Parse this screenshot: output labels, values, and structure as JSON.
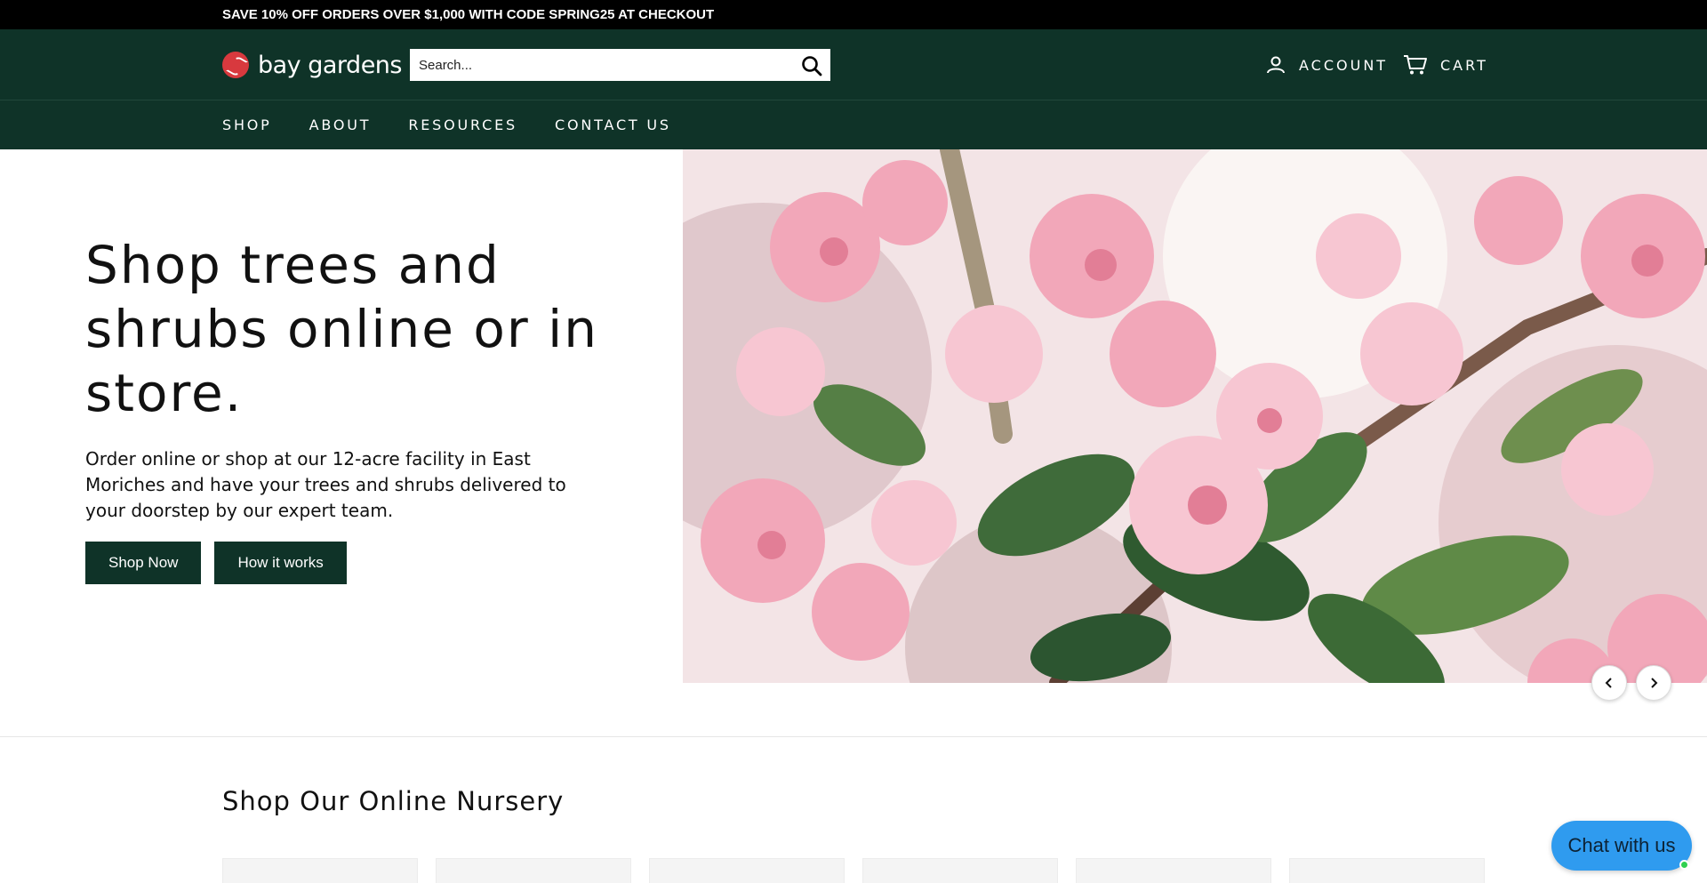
{
  "announcement": "SAVE 10% OFF ORDERS OVER $1,000 WITH CODE SPRING25 AT CHECKOUT",
  "header": {
    "logo_text": "bay gardens",
    "search_placeholder": "Search...",
    "account_label": "ACCOUNT",
    "cart_label": "CART"
  },
  "nav": {
    "items": [
      "SHOP",
      "ABOUT",
      "RESOURCES",
      "CONTACT US"
    ]
  },
  "hero": {
    "title": "Shop trees and shrubs online or in store.",
    "subtitle": "Order online or shop at our 12-acre facility in East Moriches and have your trees and shrubs delivered to your doorstep by our expert team.",
    "primary_button": "Shop Now",
    "secondary_button": "How it works"
  },
  "section": {
    "title": "Shop Our Online Nursery"
  },
  "chat": {
    "label": "Chat with us"
  },
  "colors": {
    "brand_green": "#0f3328",
    "announce_bg": "#000000",
    "logo_red": "#d8393e",
    "chat_blue": "#2f9bef"
  }
}
